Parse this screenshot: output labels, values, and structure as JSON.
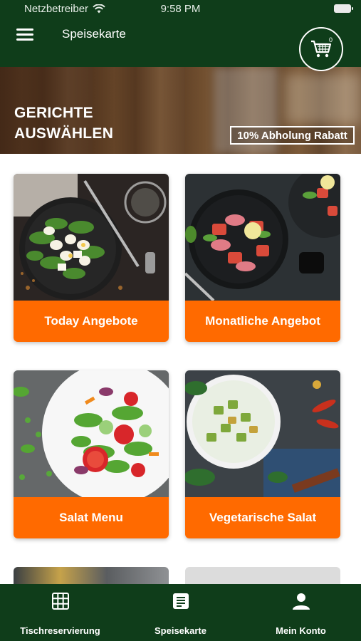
{
  "status_bar": {
    "carrier": "Netzbetreiber",
    "time": "9:58 PM"
  },
  "header": {
    "title": "Speisekarte",
    "cart_count": "0"
  },
  "banner": {
    "heading_line1": "GERICHTE",
    "heading_line2": "AUSWÄHLEN",
    "promo": "10% Abholung Rabatt"
  },
  "categories": [
    {
      "label": "Today Angebote"
    },
    {
      "label": "Monatliche Angebot"
    },
    {
      "label": "Salat Menu"
    },
    {
      "label": "Vegetarische Salat"
    }
  ],
  "bottom_nav": [
    {
      "label": "Tischreservierung",
      "icon": "grid-icon"
    },
    {
      "label": "Speisekarte",
      "icon": "menu-list-icon"
    },
    {
      "label": "Mein Konto",
      "icon": "user-icon"
    }
  ],
  "colors": {
    "primary": "#0f3d1a",
    "accent": "#ff6a00"
  }
}
